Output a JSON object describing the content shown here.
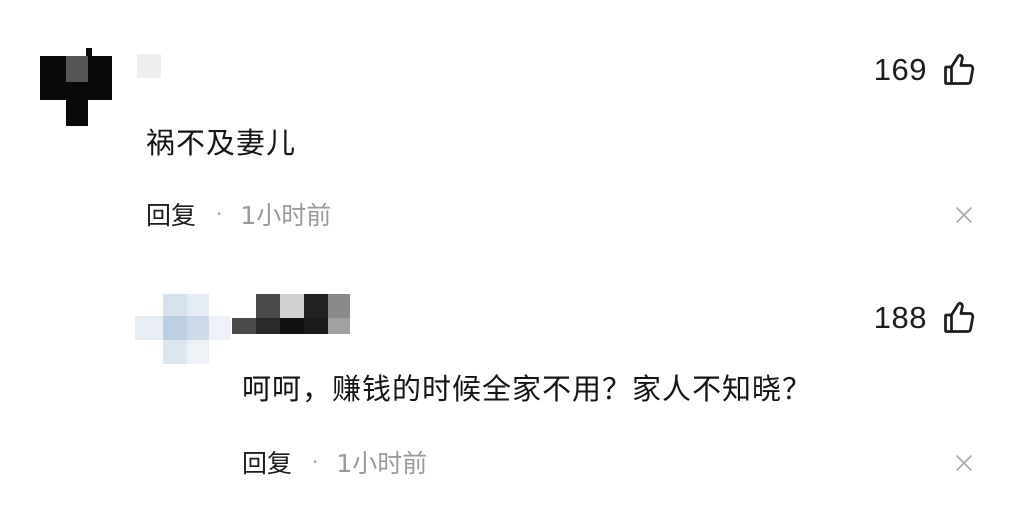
{
  "comments": [
    {
      "text": "祸不及妻儿",
      "likes": "169",
      "reply_label": "回复",
      "separator": "·",
      "time": "1小时前"
    },
    {
      "text": "呵呵，赚钱的时候全家不用？家人不知晓？",
      "likes": "188",
      "reply_label": "回复",
      "separator": "·",
      "time": "1小时前"
    }
  ],
  "icons": {
    "like": "thumbs-up-icon",
    "dismiss": "close-icon"
  },
  "colors": {
    "text_primary": "#141414",
    "text_secondary": "#9a9a9a",
    "background": "#ffffff"
  }
}
